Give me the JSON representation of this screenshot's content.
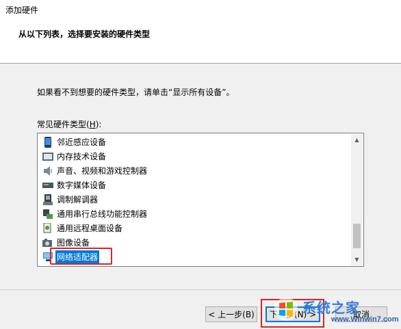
{
  "window": {
    "title": "添加硬件"
  },
  "header": {
    "heading": "从以下列表，选择要安装的硬件类型"
  },
  "instruction": "如果看不到想要的硬件类型，请单击“显示所有设备”。",
  "list": {
    "label_prefix": "常见硬件类型(",
    "label_access": "H",
    "label_suffix": "):",
    "items": [
      {
        "label": "邻近感应设备",
        "icon": "phone-icon"
      },
      {
        "label": "内存技术设备",
        "icon": "memory-card-icon"
      },
      {
        "label": "声音、视频和游戏控制器",
        "icon": "speaker-icon"
      },
      {
        "label": "数字媒体设备",
        "icon": "media-device-icon"
      },
      {
        "label": "调制解调器",
        "icon": "modem-icon"
      },
      {
        "label": "通用串行总线功能控制器",
        "icon": "usb-controller-icon"
      },
      {
        "label": "通用远程桌面设备",
        "icon": "remote-desktop-icon"
      },
      {
        "label": "图像设备",
        "icon": "camera-icon"
      },
      {
        "label": "网络适配器",
        "icon": "network-adapter-icon",
        "selected": true
      }
    ]
  },
  "buttons": {
    "back": "< 上一步(B)",
    "next": "下一步(N) >",
    "cancel": "取消"
  },
  "watermark": {
    "name": "系统之家",
    "site": "www.Winwin7.com"
  },
  "colors": {
    "selection": "#0078d7",
    "highlight": "#e02020"
  }
}
